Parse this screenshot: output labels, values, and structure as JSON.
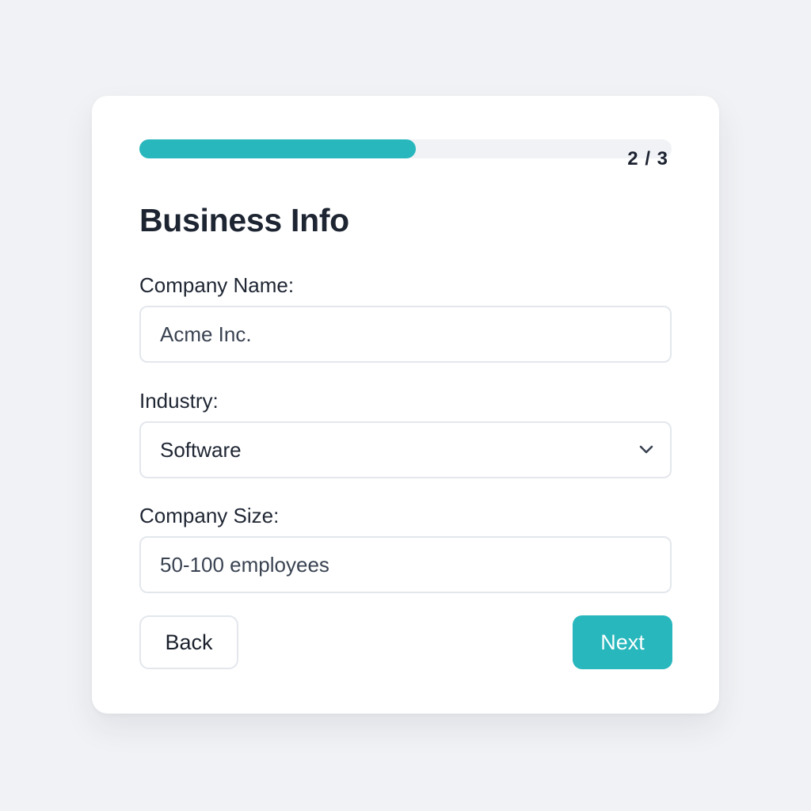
{
  "progress": {
    "step_text": "2 / 3",
    "fraction": 0.52,
    "fill_color": "#27b7bd"
  },
  "form": {
    "title": "Business Info",
    "company_name": {
      "label": "Company Name:",
      "value": "Acme Inc."
    },
    "industry": {
      "label": "Industry:",
      "selected": "Software",
      "icon": "chevron-down-icon"
    },
    "company_size": {
      "label": "Company Size:",
      "value": "50-100 employees"
    }
  },
  "actions": {
    "back_label": "Back",
    "next_label": "Next",
    "accent_color": "#27b7bd"
  }
}
